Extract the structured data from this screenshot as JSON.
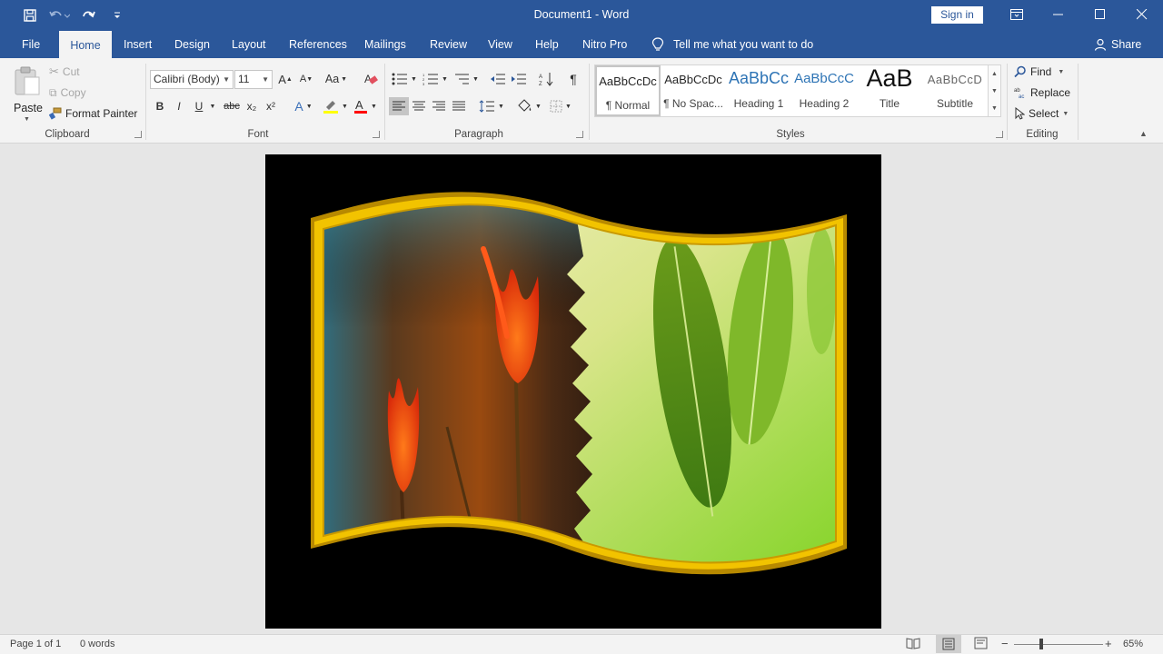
{
  "window": {
    "title": "Document1 - Word",
    "sign_in": "Sign in"
  },
  "qat": {
    "icons": [
      "save-icon",
      "undo-icon",
      "redo-icon",
      "customize-qat-icon"
    ]
  },
  "tabs": [
    {
      "label": "File"
    },
    {
      "label": "Home"
    },
    {
      "label": "Insert"
    },
    {
      "label": "Design"
    },
    {
      "label": "Layout"
    },
    {
      "label": "References"
    },
    {
      "label": "Mailings"
    },
    {
      "label": "Review"
    },
    {
      "label": "View"
    },
    {
      "label": "Help"
    },
    {
      "label": "Nitro Pro"
    }
  ],
  "tell_me": "Tell me what you want to do",
  "share": "Share",
  "clipboard": {
    "paste": "Paste",
    "cut": "Cut",
    "copy": "Copy",
    "format_painter": "Format Painter",
    "group_label": "Clipboard"
  },
  "font": {
    "font_name": "Calibri (Body)",
    "font_size": "11",
    "change_case": "Aa",
    "bold": "B",
    "italic": "I",
    "underline": "U",
    "strikethrough": "abc",
    "subscript": "x₂",
    "superscript": "x²",
    "group_label": "Font"
  },
  "paragraph": {
    "group_label": "Paragraph"
  },
  "styles": {
    "items": [
      {
        "sample": "AaBbCcDc",
        "name": "¶ Normal",
        "selected": true
      },
      {
        "sample": "AaBbCcDc",
        "name": "¶ No Spac..."
      },
      {
        "sample": "AaBbCc",
        "name": "Heading 1"
      },
      {
        "sample": "AaBbCcC",
        "name": "Heading 2"
      },
      {
        "sample": "AaB",
        "name": "Title"
      },
      {
        "sample": "AaBbCcD",
        "name": "Subtitle"
      }
    ],
    "group_label": "Styles"
  },
  "editing": {
    "find": "Find",
    "replace": "Replace",
    "select": "Select",
    "group_label": "Editing"
  },
  "status": {
    "page": "Page 1 of 1",
    "words": "0 words",
    "zoom": "65%"
  },
  "colors": {
    "accent": "#2b579a",
    "frame_gold": "#f2c300",
    "highlight": "#ffff00",
    "font_color": "#ff0000"
  }
}
